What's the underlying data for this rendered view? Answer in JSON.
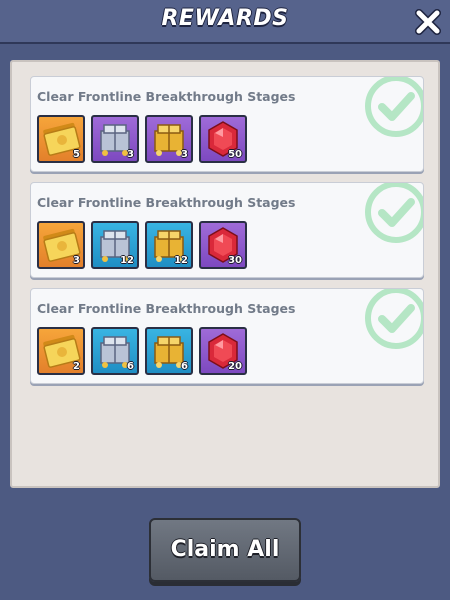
{
  "header": {
    "title": "REWARDS"
  },
  "rewards": [
    {
      "title": "Clear Frontline Breakthrough Stages",
      "completed": true,
      "items": [
        {
          "icon": "gold-ticket-icon",
          "bg": "orange",
          "qty": "5"
        },
        {
          "icon": "silver-crate-icon",
          "bg": "purple",
          "qty": "3"
        },
        {
          "icon": "gold-crate-icon",
          "bg": "purple",
          "qty": "3"
        },
        {
          "icon": "ruby-gem-icon",
          "bg": "purple",
          "qty": "50"
        }
      ]
    },
    {
      "title": "Clear Frontline Breakthrough Stages",
      "completed": true,
      "items": [
        {
          "icon": "gold-ticket-icon",
          "bg": "orange",
          "qty": "3"
        },
        {
          "icon": "silver-crate-icon",
          "bg": "blue",
          "qty": "12"
        },
        {
          "icon": "gold-crate-icon",
          "bg": "blue",
          "qty": "12"
        },
        {
          "icon": "ruby-gem-icon",
          "bg": "purple",
          "qty": "30"
        }
      ]
    },
    {
      "title": "Clear Frontline Breakthrough Stages",
      "completed": true,
      "items": [
        {
          "icon": "gold-ticket-icon",
          "bg": "orange",
          "qty": "2"
        },
        {
          "icon": "silver-crate-icon",
          "bg": "blue",
          "qty": "6"
        },
        {
          "icon": "gold-crate-icon",
          "bg": "blue",
          "qty": "6"
        },
        {
          "icon": "ruby-gem-icon",
          "bg": "purple",
          "qty": "20"
        }
      ]
    }
  ],
  "footer": {
    "claim_label": "Claim All"
  },
  "colors": {
    "background": "#4d5a82",
    "panel": "#e8e3df",
    "card": "#f7f8fa",
    "check": "#b5e6c5",
    "item_orange": "#f39a35",
    "item_purple": "#8c59cc",
    "item_blue": "#2ea3d6"
  }
}
